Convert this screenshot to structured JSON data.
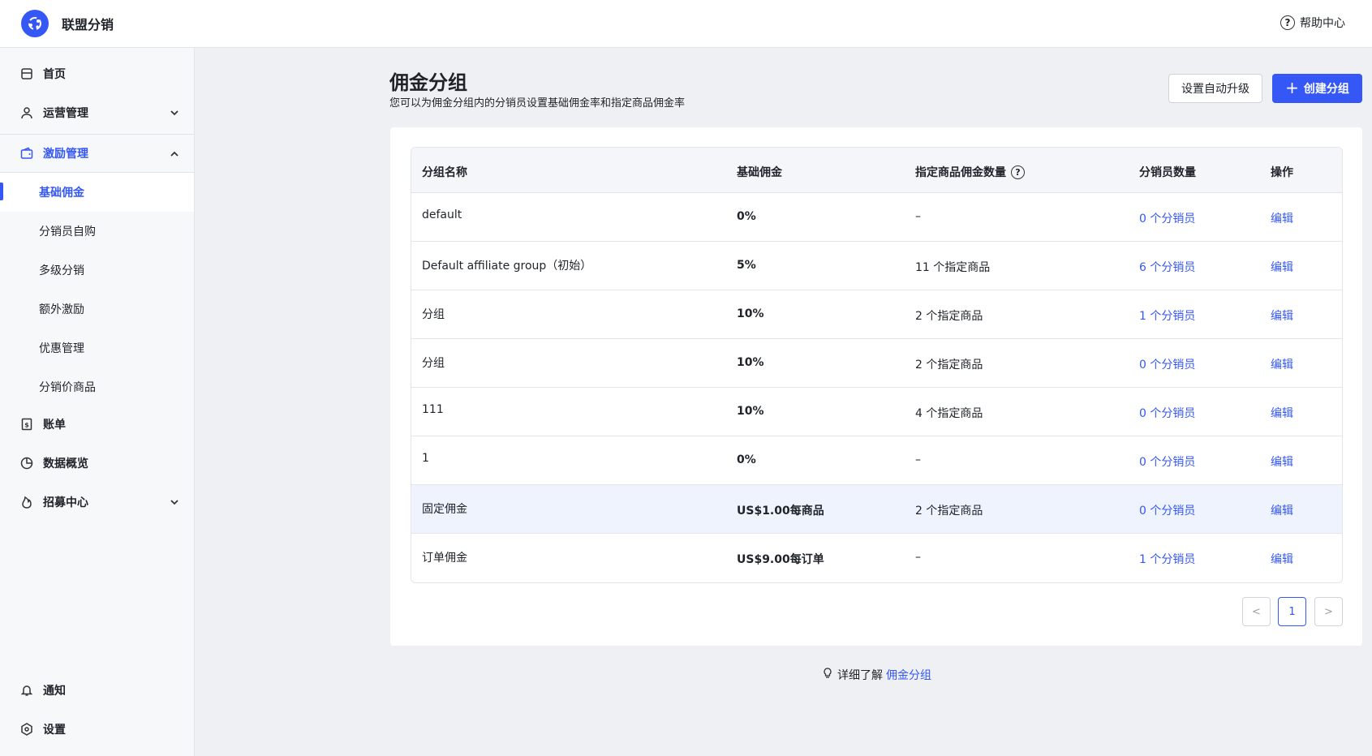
{
  "app": {
    "name": "联盟分销",
    "help_label": "帮助中心"
  },
  "sidebar": {
    "items": [
      {
        "label": "首页",
        "icon": "store-icon"
      },
      {
        "label": "运营管理",
        "icon": "user-icon"
      },
      {
        "label": "激励管理",
        "icon": "wallet-icon"
      },
      {
        "label": "账单",
        "icon": "receipt-icon"
      },
      {
        "label": "数据概览",
        "icon": "pie-chart-icon"
      },
      {
        "label": "招募中心",
        "icon": "fire-icon"
      },
      {
        "label": "通知",
        "icon": "bell-icon"
      },
      {
        "label": "设置",
        "icon": "settings-icon"
      }
    ],
    "sub_items": [
      "基础佣金",
      "分销员自购",
      "多级分销",
      "额外激励",
      "优惠管理",
      "分销价商品"
    ]
  },
  "page": {
    "title": "佣金分组",
    "description": "您可以为佣金分组内的分销员设置基础佣金率和指定商品佣金率",
    "auto_upgrade_label": "设置自动升级",
    "create_group_label": "创建分组"
  },
  "table": {
    "headers": [
      "分组名称",
      "基础佣金",
      "指定商品佣金数量",
      "分销员数量",
      "操作"
    ],
    "rows": [
      {
        "name": "default",
        "base": "0%",
        "specified": "–",
        "affiliates": "0 个分销员",
        "action": "编辑"
      },
      {
        "name": "Default affiliate group（初始）",
        "base": "5%",
        "specified": "11 个指定商品",
        "affiliates": "6 个分销员",
        "action": "编辑"
      },
      {
        "name": "分组",
        "base": "10%",
        "specified": "2 个指定商品",
        "affiliates": "1 个分销员",
        "action": "编辑"
      },
      {
        "name": "分组",
        "base": "10%",
        "specified": "2 个指定商品",
        "affiliates": "0 个分销员",
        "action": "编辑"
      },
      {
        "name": "111",
        "base": "10%",
        "specified": "4 个指定商品",
        "affiliates": "0 个分销员",
        "action": "编辑"
      },
      {
        "name": "1",
        "base": "0%",
        "specified": "–",
        "affiliates": "0 个分销员",
        "action": "编辑"
      },
      {
        "name": "固定佣金",
        "base": "US$1.00每商品",
        "specified": "2 个指定商品",
        "affiliates": "0 个分销员",
        "action": "编辑"
      },
      {
        "name": "订单佣金",
        "base": "US$9.00每订单",
        "specified": "–",
        "affiliates": "1 个分销员",
        "action": "编辑"
      }
    ]
  },
  "pagination": {
    "prev": "<",
    "current": "1",
    "next": ">"
  },
  "footer": {
    "learn_prefix": "详细了解",
    "learn_link": "佣金分组"
  },
  "colors": {
    "accent": "#3457f5",
    "sidebar_bg": "#f7f8fa",
    "page_bg": "#eff0f4"
  }
}
